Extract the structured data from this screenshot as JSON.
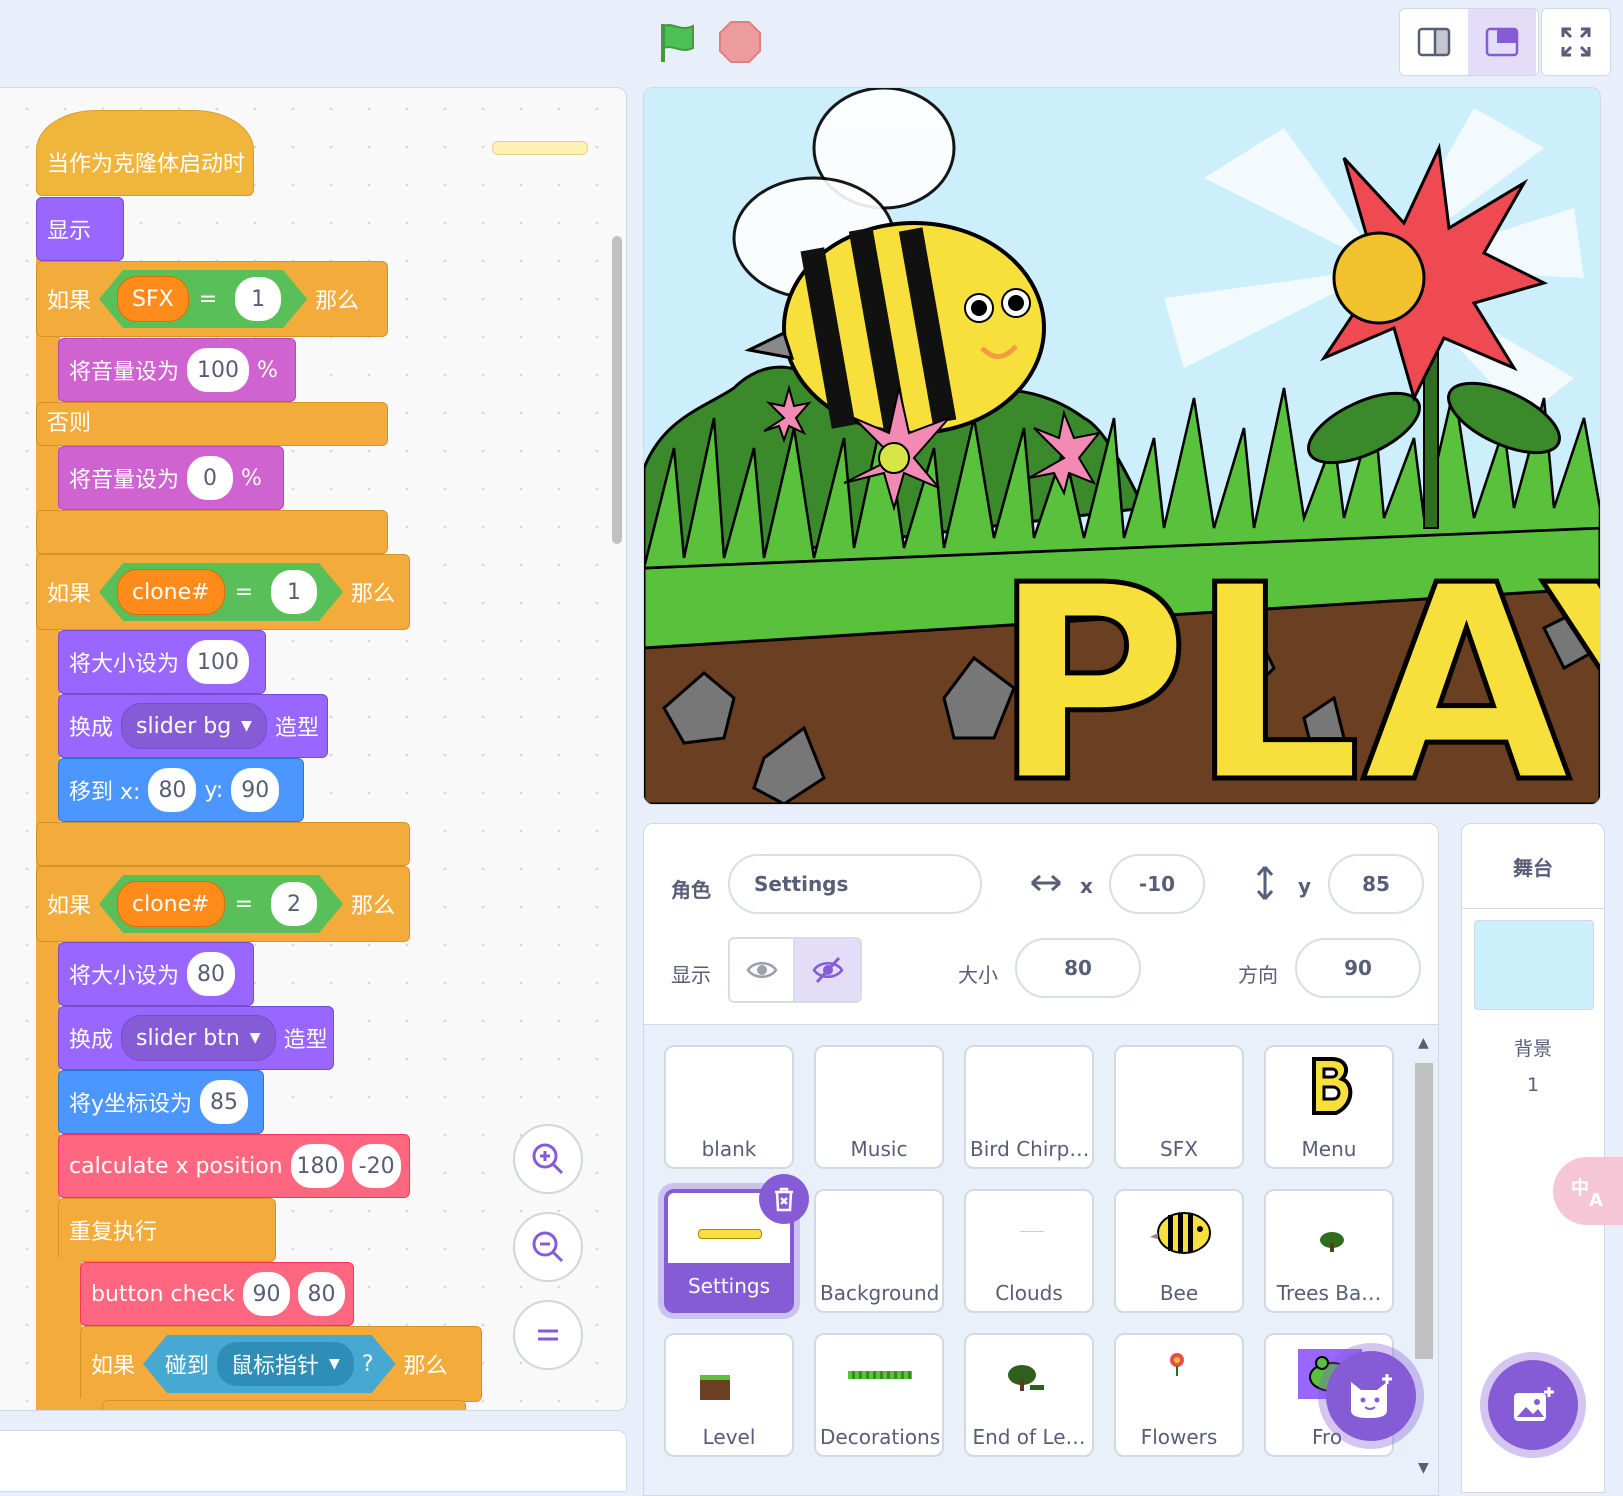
{
  "controls": {
    "flag_icon": "green-flag-icon",
    "stop_icon": "stop-icon"
  },
  "code": {
    "hat": "当作为克隆体启动时",
    "show": "显示",
    "if1": {
      "kw": "如果",
      "var": "SFX",
      "eq": "=",
      "val": "1",
      "then": "那么"
    },
    "setvol1": {
      "label": "将音量设为",
      "val": "100",
      "unit": "%"
    },
    "else": "否则",
    "setvol2": {
      "label": "将音量设为",
      "val": "0",
      "unit": "%"
    },
    "if2": {
      "kw": "如果",
      "var": "clone#",
      "eq": "=",
      "val": "1",
      "then": "那么"
    },
    "size1": {
      "label": "将大小设为",
      "val": "100"
    },
    "switch1": {
      "label": "换成",
      "costume": "slider bg",
      "suffix": "造型"
    },
    "goto": {
      "label": "移到 x:",
      "x": "80",
      "ylabel": "y:",
      "y": "90"
    },
    "if3": {
      "kw": "如果",
      "var": "clone#",
      "eq": "=",
      "val": "2",
      "then": "那么"
    },
    "size2": {
      "label": "将大小设为",
      "val": "80"
    },
    "switch2": {
      "label": "换成",
      "costume": "slider btn",
      "suffix": "造型"
    },
    "sety": {
      "label": "将y坐标设为",
      "val": "85"
    },
    "calc": {
      "label": "calculate x position",
      "a": "180",
      "b": "-20"
    },
    "forever": "重复执行",
    "btncheck": {
      "label": "button check",
      "a": "90",
      "b": "80"
    },
    "if4": {
      "kw": "如果",
      "sense": "碰到",
      "target": "鼠标指针",
      "q": "?",
      "then": "那么"
    }
  },
  "stage_text": "PLAY",
  "sprite_info": {
    "sprite_label": "角色",
    "sprite_name": "Settings",
    "x_label": "x",
    "x": "-10",
    "y_label": "y",
    "y": "85",
    "show_label": "显示",
    "size_label": "大小",
    "size": "80",
    "direction_label": "方向",
    "direction": "90"
  },
  "sprites": [
    {
      "name": "blank"
    },
    {
      "name": "Music"
    },
    {
      "name": "Bird Chirp…"
    },
    {
      "name": "SFX"
    },
    {
      "name": "Menu"
    },
    {
      "name": "Settings"
    },
    {
      "name": "Background"
    },
    {
      "name": "Clouds"
    },
    {
      "name": "Bee"
    },
    {
      "name": "Trees Ba…"
    },
    {
      "name": "Level"
    },
    {
      "name": "Decorations"
    },
    {
      "name": "End of Le…"
    },
    {
      "name": "Flowers"
    },
    {
      "name": "Fro"
    }
  ],
  "stage_panel": {
    "title": "舞台",
    "backdrops_label": "背景",
    "backdrops_count": "1"
  },
  "colors": {
    "accent": "#855cd6",
    "events": "#ffbf00",
    "control": "#ffab19",
    "looks": "#9966ff",
    "sound": "#cf63cf",
    "motion": "#4c97ff",
    "myblocks": "#ff6680"
  }
}
